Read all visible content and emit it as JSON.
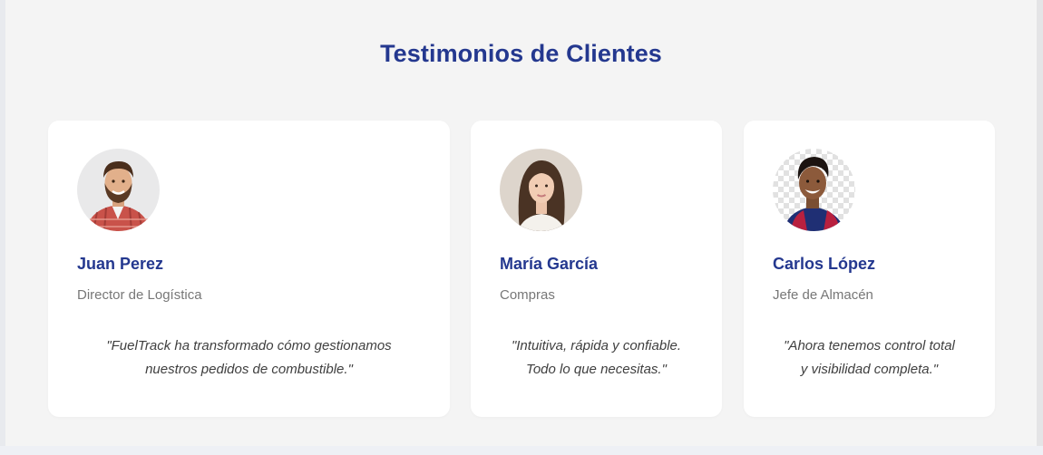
{
  "section": {
    "title": "Testimonios de Clientes"
  },
  "testimonials": [
    {
      "name": "Juan Perez",
      "role": "Director de Logística",
      "quote_line1": "\"FuelTrack ha transformado cómo gestionamos",
      "quote_line2": "nuestros pedidos de combustible.\"",
      "avatar_icon": "bearded-man-plaid-shirt-avatar"
    },
    {
      "name": "María García",
      "role": "Compras",
      "quote_line1": "\"Intuitiva, rápida y confiable.",
      "quote_line2": "Todo lo que necesitas.\"",
      "avatar_icon": "young-woman-brown-hair-avatar"
    },
    {
      "name": "Carlos López",
      "role": "Jefe de Almacén",
      "quote_line1": "\"Ahora tenemos control total",
      "quote_line2": "y visibilidad completa.\"",
      "avatar_icon": "smiling-young-man-jersey-avatar"
    }
  ],
  "colors": {
    "page_background": "#f4f4f4",
    "card_background": "#ffffff",
    "accent": "#24388f",
    "role_text": "#777777",
    "quote_text": "#3f3f3f"
  }
}
